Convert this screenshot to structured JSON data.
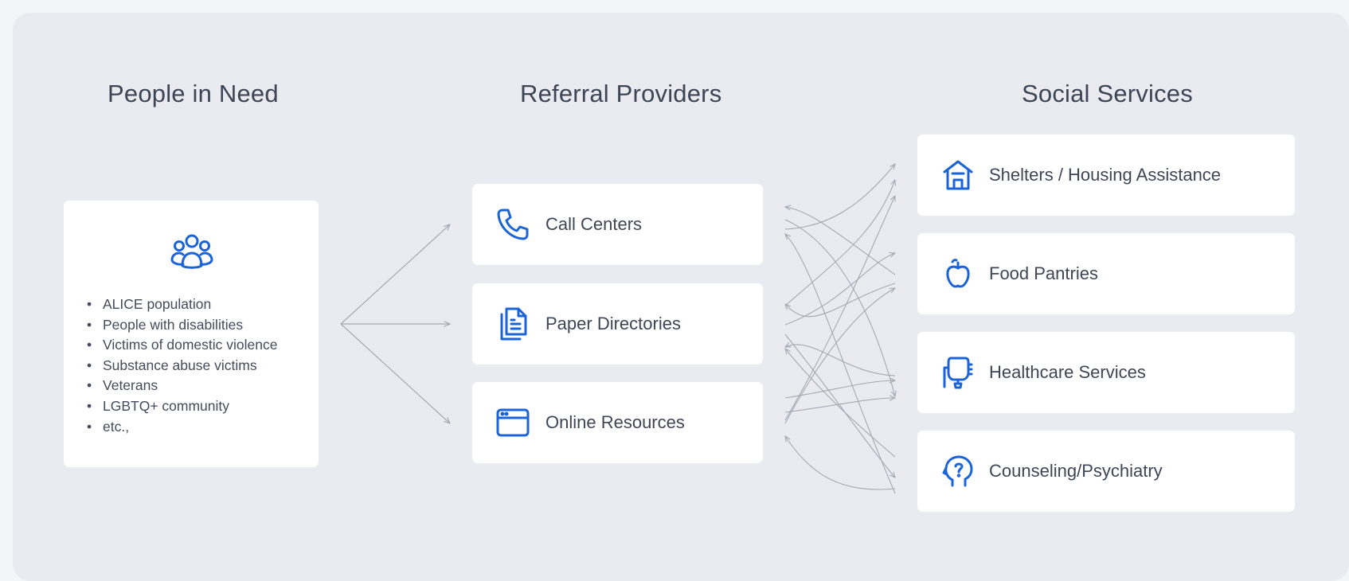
{
  "columns": {
    "people": "People in Need",
    "referral": "Referral Providers",
    "services": "Social Services"
  },
  "people": {
    "icon": "people-group-icon",
    "items": [
      "ALICE population",
      "People with disabilities",
      "Victims of domestic violence",
      "Substance abuse victims",
      "Veterans",
      "LGBTQ+ community",
      "etc.,"
    ]
  },
  "referral": [
    {
      "label": "Call Centers",
      "icon": "phone-icon"
    },
    {
      "label": "Paper Directories",
      "icon": "document-icon"
    },
    {
      "label": "Online Resources",
      "icon": "browser-window-icon"
    }
  ],
  "services": [
    {
      "label": "Shelters / Housing Assistance",
      "icon": "house-icon"
    },
    {
      "label": "Food Pantries",
      "icon": "apple-icon"
    },
    {
      "label": "Healthcare Services",
      "icon": "iv-bag-icon"
    },
    {
      "label": "Counseling/Psychiatry",
      "icon": "head-question-icon"
    }
  ],
  "colors": {
    "accent": "#1a63d8",
    "background": "#e9ebf0",
    "card": "#ffffff",
    "text": "#3e4656",
    "connector": "#a4a9b3"
  }
}
